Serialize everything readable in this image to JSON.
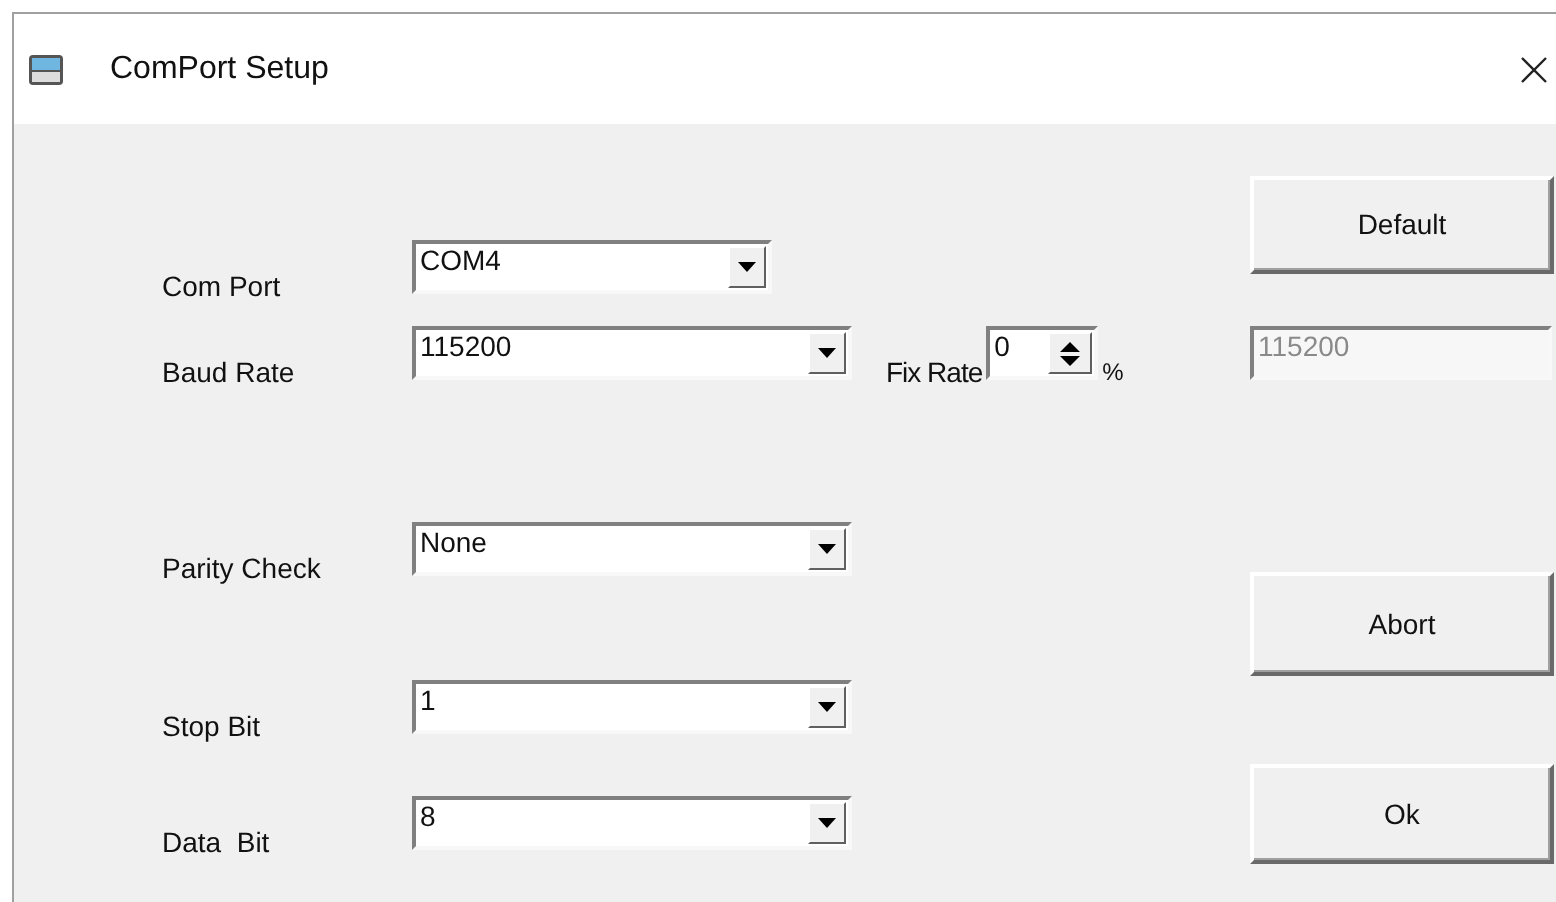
{
  "window": {
    "title": "ComPort Setup"
  },
  "fields": [
    {
      "label": "Com Port",
      "value": "COM4",
      "kind": "combo"
    },
    {
      "label": "Baud Rate",
      "value": "115200",
      "kind": "combo"
    },
    {
      "label": "Parity Check",
      "value": "None",
      "kind": "combo"
    },
    {
      "label": "Stop Bit",
      "value": "1",
      "kind": "combo"
    },
    {
      "label": "Data  Bit",
      "value": "8",
      "kind": "combo"
    }
  ],
  "fix_rate": {
    "label": "Fix Rate",
    "value": "0",
    "unit": "%",
    "result": "115200",
    "result_disabled": true
  },
  "buttons": [
    "Default",
    "Abort",
    "Ok"
  ]
}
